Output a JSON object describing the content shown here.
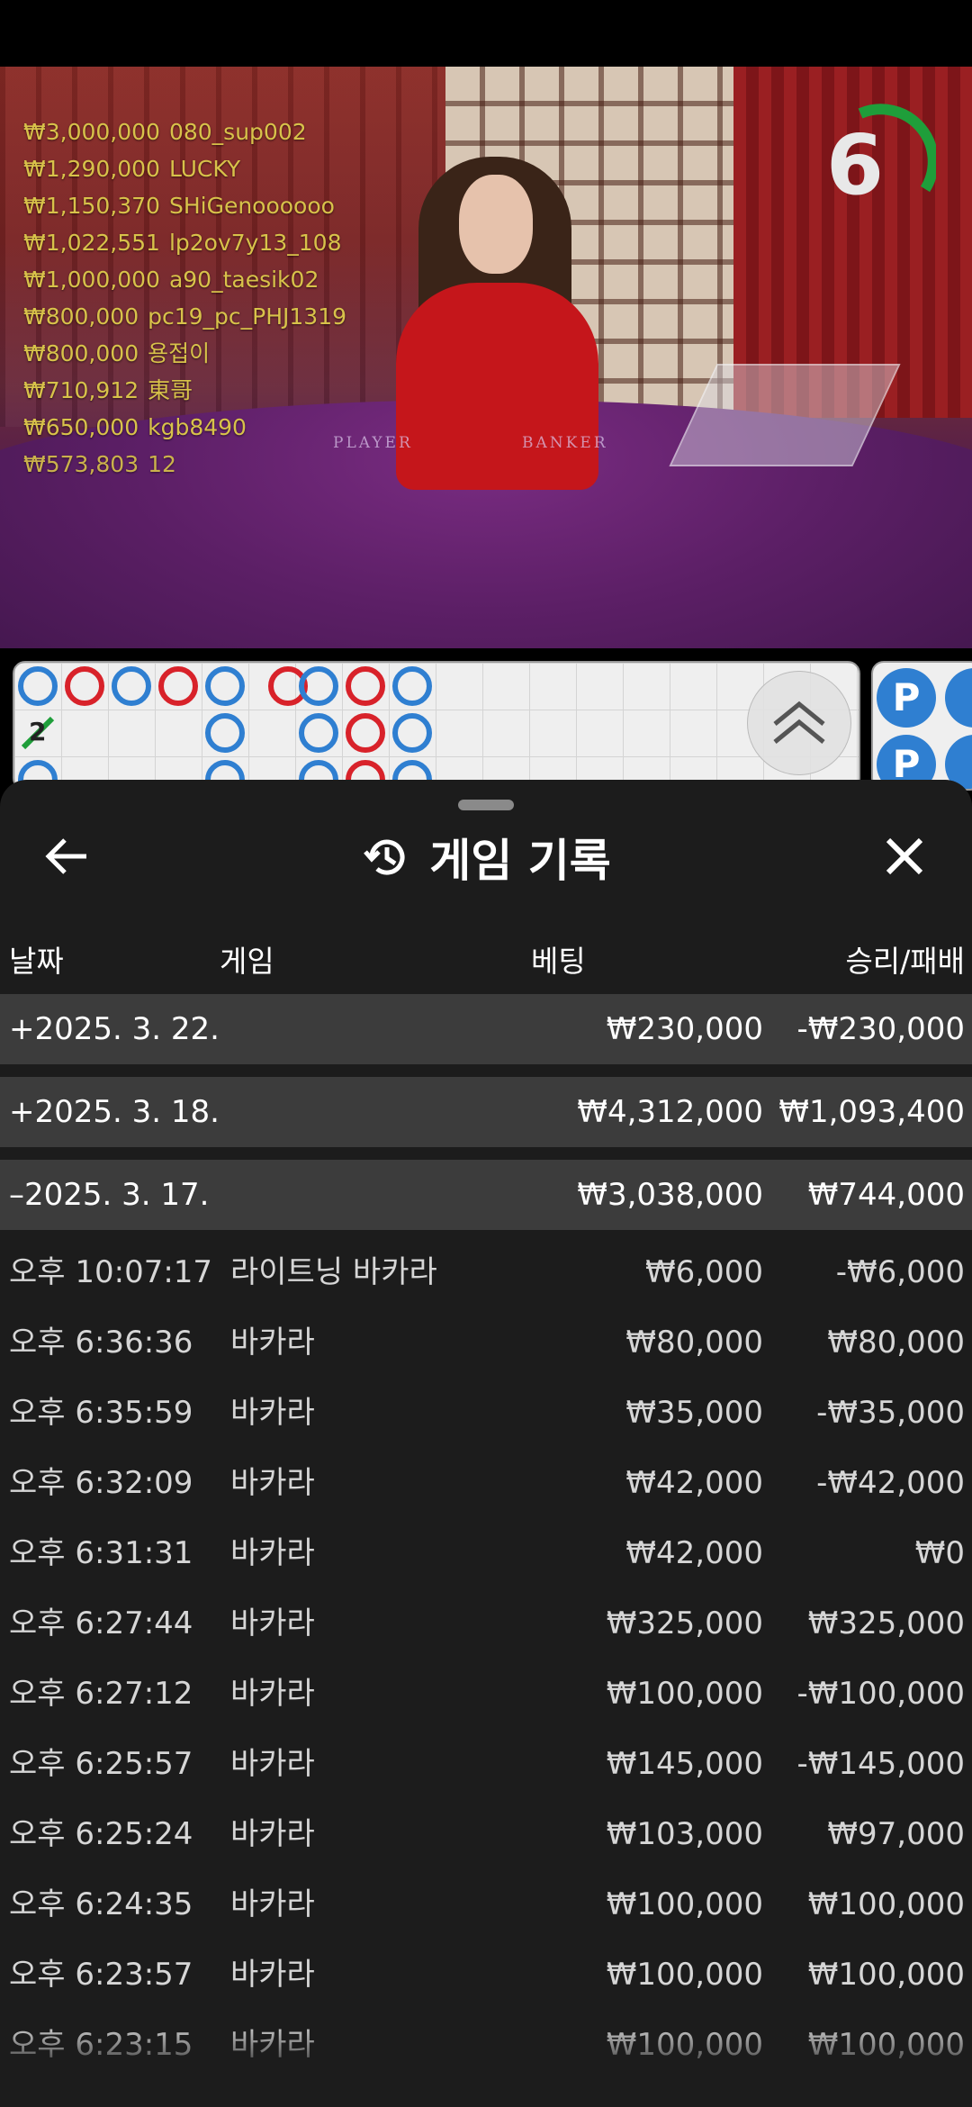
{
  "timer": {
    "value": "6",
    "progress": 0.3
  },
  "leaderboard": [
    {
      "amount": "₩3,000,000",
      "user": "080_sup002"
    },
    {
      "amount": "₩1,290,000",
      "user": "LUCKY"
    },
    {
      "amount": "₩1,150,370",
      "user": "SHiGenoooooo"
    },
    {
      "amount": "₩1,022,551",
      "user": "lp2ov7y13_108"
    },
    {
      "amount": "₩1,000,000",
      "user": "a90_taesik02"
    },
    {
      "amount": "₩800,000",
      "user": "pc19_pc_PHJ1319"
    },
    {
      "amount": "₩800,000",
      "user": "용접이"
    },
    {
      "amount": "₩710,912",
      "user": "東哥"
    },
    {
      "amount": "₩650,000",
      "user": "kgb8490"
    },
    {
      "amount": "₩573,803",
      "user": "12"
    }
  ],
  "table": {
    "player_label": "PLAYER",
    "banker_label": "BANKER"
  },
  "road": {
    "tie_count": "2",
    "side_chip_label": "P"
  },
  "sheet": {
    "title": "게임 기록",
    "columns": {
      "date": "날짜",
      "game": "게임",
      "bet": "베팅",
      "result": "승리/패배"
    },
    "groups": [
      {
        "date": "+2025. 3. 22.",
        "bet": "₩230,000",
        "result": "-₩230,000"
      },
      {
        "date": "+2025. 3. 18.",
        "bet": "₩4,312,000",
        "result": "₩1,093,400"
      },
      {
        "date": "–2025. 3. 17.",
        "bet": "₩3,038,000",
        "result": "₩744,000"
      }
    ],
    "rows": [
      {
        "time": "오후 10:07:17",
        "game": "라이트닝 바카라",
        "bet": "₩6,000",
        "result": "-₩6,000"
      },
      {
        "time": "오후 6:36:36",
        "game": "바카라",
        "bet": "₩80,000",
        "result": "₩80,000"
      },
      {
        "time": "오후 6:35:59",
        "game": "바카라",
        "bet": "₩35,000",
        "result": "-₩35,000"
      },
      {
        "time": "오후 6:32:09",
        "game": "바카라",
        "bet": "₩42,000",
        "result": "-₩42,000"
      },
      {
        "time": "오후 6:31:31",
        "game": "바카라",
        "bet": "₩42,000",
        "result": "₩0"
      },
      {
        "time": "오후 6:27:44",
        "game": "바카라",
        "bet": "₩325,000",
        "result": "₩325,000"
      },
      {
        "time": "오후 6:27:12",
        "game": "바카라",
        "bet": "₩100,000",
        "result": "-₩100,000"
      },
      {
        "time": "오후 6:25:57",
        "game": "바카라",
        "bet": "₩145,000",
        "result": "-₩145,000"
      },
      {
        "time": "오후 6:25:24",
        "game": "바카라",
        "bet": "₩103,000",
        "result": "₩97,000"
      },
      {
        "time": "오후 6:24:35",
        "game": "바카라",
        "bet": "₩100,000",
        "result": "₩100,000"
      },
      {
        "time": "오후 6:23:57",
        "game": "바카라",
        "bet": "₩100,000",
        "result": "₩100,000"
      },
      {
        "time": "오후 6:23:15",
        "game": "바카라",
        "bet": "₩100,000",
        "result": "₩100,000"
      }
    ]
  }
}
